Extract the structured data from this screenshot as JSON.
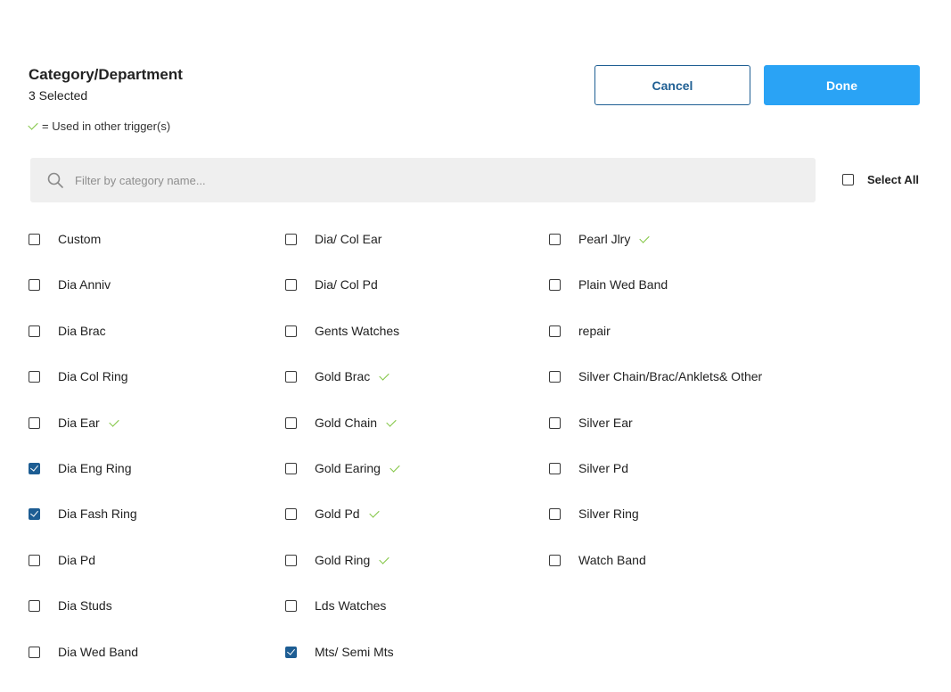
{
  "header": {
    "title": "Category/Department",
    "selected_count": "3 Selected",
    "legend_text": "= Used in other trigger(s)"
  },
  "buttons": {
    "cancel_label": "Cancel",
    "done_label": "Done"
  },
  "search": {
    "placeholder": "Filter by category name...",
    "value": "",
    "icon": "search-icon"
  },
  "select_all": {
    "label": "Select All",
    "checked": false
  },
  "colors": {
    "primary_button": "#2aa3f5",
    "cancel_border": "#1f5f93",
    "checkbox_checked": "#1d5d93",
    "used_check": "#7cc33b",
    "search_bg": "#efefef"
  },
  "columns": [
    [
      {
        "label": "Custom",
        "checked": false,
        "used": false
      },
      {
        "label": "Dia Anniv",
        "checked": false,
        "used": false
      },
      {
        "label": "Dia Brac",
        "checked": false,
        "used": false
      },
      {
        "label": "Dia Col Ring",
        "checked": false,
        "used": false
      },
      {
        "label": "Dia Ear",
        "checked": false,
        "used": true
      },
      {
        "label": "Dia Eng Ring",
        "checked": true,
        "used": false
      },
      {
        "label": "Dia Fash Ring",
        "checked": true,
        "used": false
      },
      {
        "label": "Dia Pd",
        "checked": false,
        "used": false
      },
      {
        "label": "Dia Studs",
        "checked": false,
        "used": false
      },
      {
        "label": "Dia Wed Band",
        "checked": false,
        "used": false
      }
    ],
    [
      {
        "label": "Dia/ Col Ear",
        "checked": false,
        "used": false
      },
      {
        "label": "Dia/ Col Pd",
        "checked": false,
        "used": false
      },
      {
        "label": "Gents Watches",
        "checked": false,
        "used": false
      },
      {
        "label": "Gold Brac",
        "checked": false,
        "used": true
      },
      {
        "label": "Gold Chain",
        "checked": false,
        "used": true
      },
      {
        "label": "Gold Earing",
        "checked": false,
        "used": true
      },
      {
        "label": "Gold Pd",
        "checked": false,
        "used": true
      },
      {
        "label": "Gold Ring",
        "checked": false,
        "used": true
      },
      {
        "label": "Lds Watches",
        "checked": false,
        "used": false
      },
      {
        "label": "Mts/ Semi Mts",
        "checked": true,
        "used": false
      }
    ],
    [
      {
        "label": "Pearl Jlry",
        "checked": false,
        "used": true
      },
      {
        "label": "Plain Wed Band",
        "checked": false,
        "used": false
      },
      {
        "label": "repair",
        "checked": false,
        "used": false
      },
      {
        "label": "Silver Chain/Brac/Anklets& Other",
        "checked": false,
        "used": false
      },
      {
        "label": "Silver Ear",
        "checked": false,
        "used": false
      },
      {
        "label": "Silver Pd",
        "checked": false,
        "used": false
      },
      {
        "label": "Silver Ring",
        "checked": false,
        "used": false
      },
      {
        "label": "Watch Band",
        "checked": false,
        "used": false
      }
    ]
  ]
}
